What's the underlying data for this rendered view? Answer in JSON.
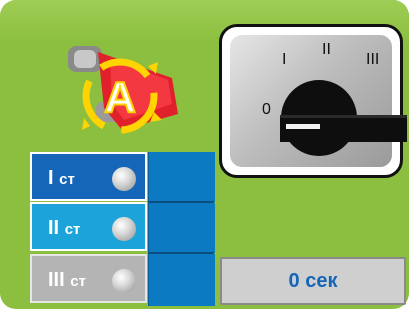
{
  "switch": {
    "labels": {
      "pos_0": "0",
      "pos_1": "I",
      "pos_2": "II",
      "pos_3": "III"
    },
    "current_position": "0"
  },
  "auto_mode": {
    "icon_letter": "A",
    "colors": {
      "ring": "#ffd400",
      "body": "#e0202a",
      "letter": "#ffffff"
    }
  },
  "stages": [
    {
      "label": "I",
      "unit": "ст",
      "color": "#1565b8"
    },
    {
      "label": "II",
      "unit": "ст",
      "color": "#1ca3d9"
    },
    {
      "label": "III",
      "unit": "ст",
      "color": "#b4b4b4"
    }
  ],
  "timer": {
    "text": "0 сек"
  },
  "colors": {
    "panel": "#8cbf3f",
    "slot": "#0c79c3",
    "timer_text": "#1565b8"
  }
}
